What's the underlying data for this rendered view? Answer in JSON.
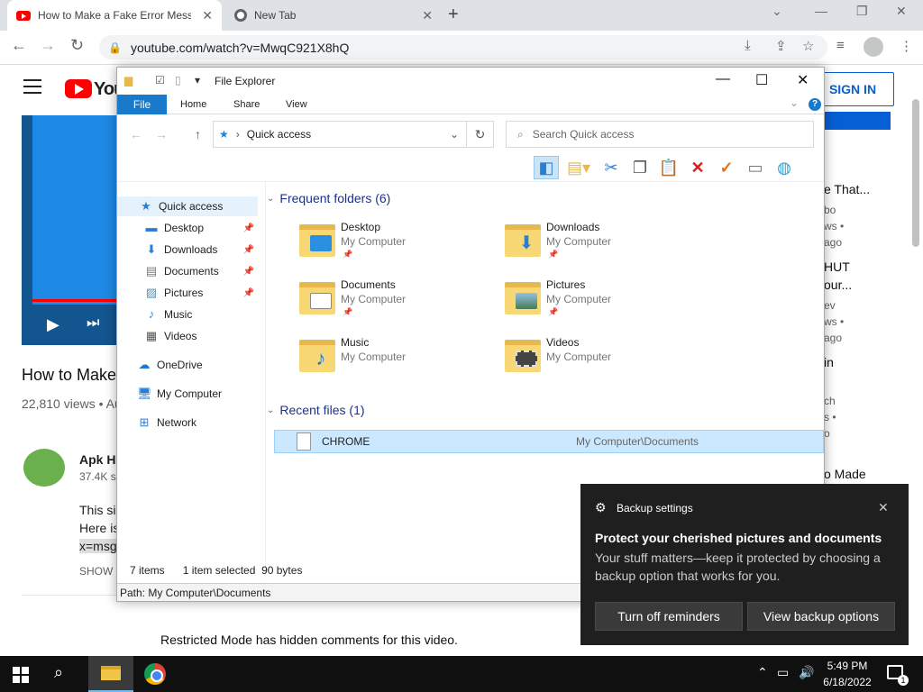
{
  "browser": {
    "tabs": [
      {
        "title": "How to Make a Fake Error Messa",
        "close": "✕"
      },
      {
        "title": "New Tab",
        "close": "✕"
      }
    ],
    "new_tab": "+",
    "url": "youtube.com/watch?v=MwqC921X8hQ"
  },
  "youtube": {
    "logo_text": "You",
    "sign_in": "SIGN IN",
    "video_title": "How to Make",
    "views": "22,810 views • Au",
    "channel": "Apk He",
    "subscribers": "37.4K s",
    "desc_lines": [
      "This si",
      "Here is",
      "x=msg"
    ],
    "show_more": "SHOW M",
    "restricted": "Restricted Mode has hidden comments for this video.",
    "sidebar": [
      "e That...",
      "bo",
      "ws •",
      "ago",
      "HUT",
      "our...",
      "ev",
      "ws •",
      "ago",
      "in",
      "ch",
      "s •",
      "o",
      "o Made"
    ]
  },
  "explorer": {
    "title": "File Explorer",
    "ribbon_tabs": [
      "File",
      "Home",
      "Share",
      "View"
    ],
    "help": "?",
    "address": "Quick access",
    "search_placeholder": "Search Quick access",
    "nav": {
      "quick_access": "Quick access",
      "desktop": "Desktop",
      "downloads": "Downloads",
      "documents": "Documents",
      "pictures": "Pictures",
      "music": "Music",
      "videos": "Videos",
      "onedrive": "OneDrive",
      "my_computer": "My Computer",
      "network": "Network"
    },
    "frequent_header": "Frequent folders (6)",
    "folders": [
      {
        "name": "Desktop",
        "location": "My Computer"
      },
      {
        "name": "Downloads",
        "location": "My Computer"
      },
      {
        "name": "Documents",
        "location": "My Computer"
      },
      {
        "name": "Pictures",
        "location": "My Computer"
      },
      {
        "name": "Music",
        "location": "My Computer"
      },
      {
        "name": "Videos",
        "location": "My Computer"
      }
    ],
    "recent_header": "Recent files (1)",
    "recent": {
      "name": "CHROME",
      "location": "My Computer\\Documents"
    },
    "status": {
      "items": "7 items",
      "selected": "1 item selected",
      "size": "90 bytes"
    },
    "path": "Path: My Computer\\Documents"
  },
  "toast": {
    "app": "Backup settings",
    "heading": "Protect your cherished pictures and documents",
    "body": "Your stuff matters—keep it protected by choosing a backup option that works for you.",
    "button1": "Turn off reminders",
    "button2": "View backup options"
  },
  "taskbar": {
    "time": "5:49 PM",
    "date": "6/18/2022",
    "notification_count": "1"
  }
}
